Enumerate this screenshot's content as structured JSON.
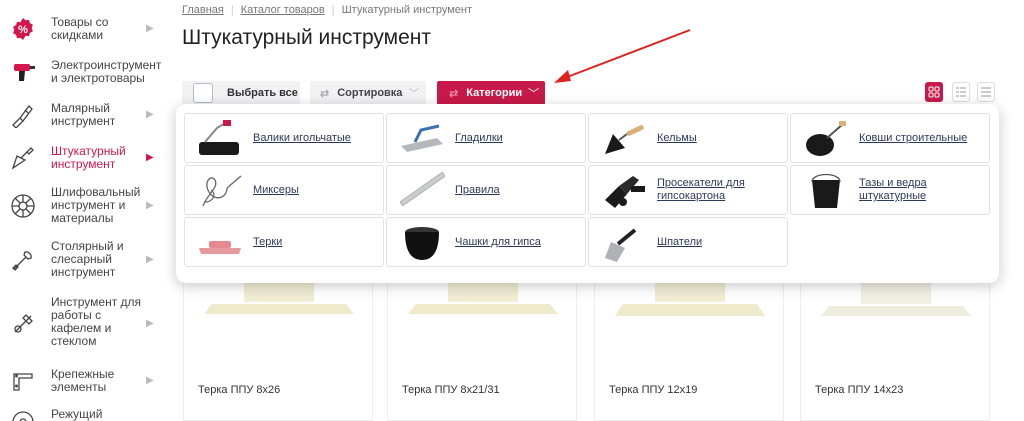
{
  "sidebar": {
    "items": [
      {
        "label": "Товары со скидками",
        "icon": "discount-icon"
      },
      {
        "label": "Электроинструмент и электротовары",
        "icon": "drill-icon"
      },
      {
        "label": "Малярный инструмент",
        "icon": "paint-brush-icon"
      },
      {
        "label": "Штукатурный инструмент",
        "icon": "trowel-icon"
      },
      {
        "label": "Шлифовальный инструмент и материалы",
        "icon": "grinding-disc-icon"
      },
      {
        "label": "Столярный и слесарный инструмент",
        "icon": "wrench-icon"
      },
      {
        "label": "Инструмент для работы с кафелем и стеклом",
        "icon": "tile-cutter-icon"
      },
      {
        "label": "Крепежные элементы",
        "icon": "bracket-icon"
      },
      {
        "label": "Режущий",
        "icon": "saw-blade-icon"
      }
    ],
    "active_index": 3,
    "accent": "#c8194a"
  },
  "breadcrumb": {
    "home": "Главная",
    "catalog": "Каталог товаров",
    "current": "Штукатурный инструмент"
  },
  "page": {
    "title": "Штукатурный инструмент"
  },
  "toolbar": {
    "select_all": "Выбрать все",
    "sort": "Сортировка",
    "categories": "Категории"
  },
  "categories": [
    {
      "label": "Валики игольчатые",
      "icon": "needle-roller-icon"
    },
    {
      "label": "Гладилки",
      "icon": "float-trowel-icon"
    },
    {
      "label": "Кельмы",
      "icon": "trowel-icon"
    },
    {
      "label": "Ковши строительные",
      "icon": "ladle-icon"
    },
    {
      "label": "Миксеры",
      "icon": "mixer-icon"
    },
    {
      "label": "Правила",
      "icon": "level-rule-icon"
    },
    {
      "label": "Просекатели для гипсокартона",
      "icon": "drywall-punch-icon"
    },
    {
      "label": "Тазы и ведра штукатурные",
      "icon": "bucket-icon"
    },
    {
      "label": "Терки",
      "icon": "grater-icon"
    },
    {
      "label": "Чашки для гипса",
      "icon": "gypsum-bowl-icon"
    },
    {
      "label": "Шпатели",
      "icon": "spatula-icon"
    }
  ],
  "products": [
    {
      "name": "Терка ППУ 8x26"
    },
    {
      "name": "Терка ППУ 8x21/31"
    },
    {
      "name": "Терка ППУ 12x19"
    },
    {
      "name": "Терка ППУ 14x23"
    }
  ]
}
